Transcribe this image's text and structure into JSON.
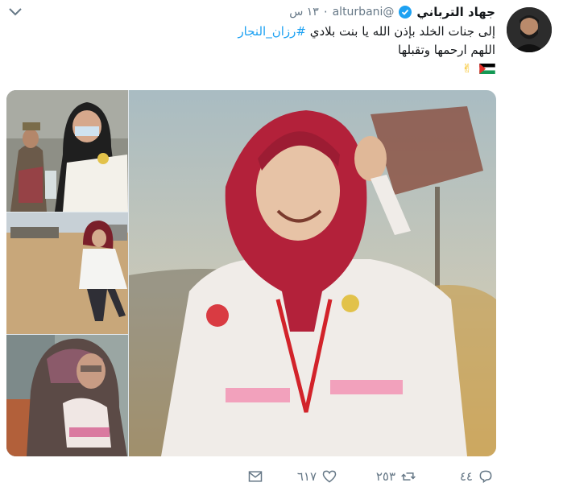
{
  "tweet": {
    "name": "جهاد الترباني",
    "handle": "@alturbani",
    "time": "١٣ س",
    "dot": "·",
    "line1_text": "إلى جنات الخلد بإذن الله يا بنت بلادي",
    "line1_hashtag": "#رزان_النجار",
    "line2_text": "اللهم ارحمها وتقبلها",
    "emoji": "✌"
  },
  "actions": {
    "reply_count": "٤٤",
    "retweet_count": "٢٥٣",
    "like_count": "٦١٧"
  },
  "colors": {
    "accent": "#1da1f2",
    "muted": "#657786"
  }
}
